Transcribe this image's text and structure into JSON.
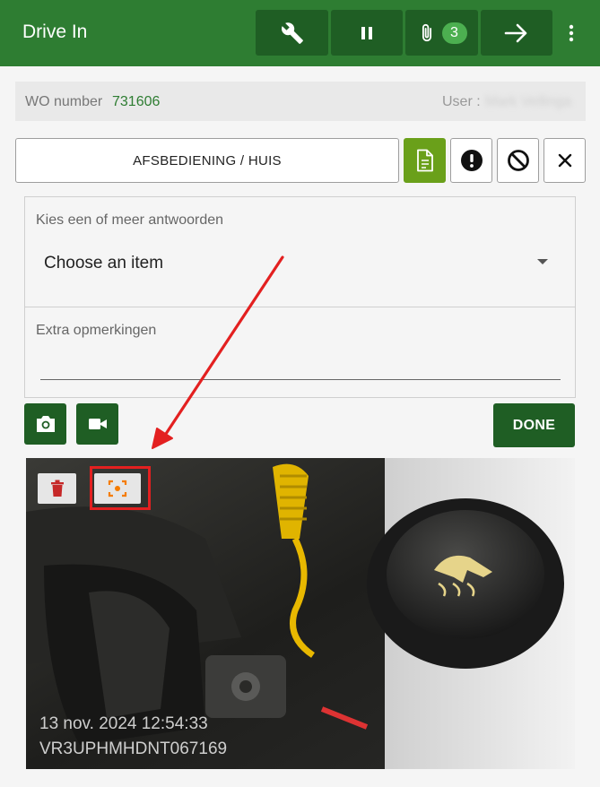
{
  "app": {
    "title": "Drive In",
    "attachments_count": "3"
  },
  "toolbar": {
    "buttons": [
      {
        "icon": "wrench-icon"
      },
      {
        "icon": "pause-icon"
      },
      {
        "icon": "paperclip-icon"
      },
      {
        "icon": "arrow-right-icon"
      }
    ],
    "menu_icon": "more-vert-icon"
  },
  "work_order": {
    "label": "WO number",
    "number": "731606",
    "user_label": "User :",
    "user_value": "Mark Vellinga"
  },
  "section": {
    "title": "AFSBEDIENING / HUIS",
    "actions": [
      {
        "icon": "document-icon",
        "color": "#6aa01a"
      },
      {
        "icon": "alert-circle-icon"
      },
      {
        "icon": "block-icon"
      },
      {
        "icon": "close-icon"
      }
    ]
  },
  "question": {
    "label": "Kies een of meer antwoorden",
    "select_value": "Choose an item",
    "extra_label": "Extra opmerkingen",
    "extra_value": ""
  },
  "media": {
    "camera_icon": "camera-icon",
    "video_icon": "video-camera-icon",
    "done_label": "DONE"
  },
  "photo": {
    "timestamp": "13 nov. 2024 12:54:33",
    "vin": "VR3UPHMHDNT067169",
    "delete_icon": "trash-icon",
    "focus_icon": "focus-crop-icon"
  },
  "colors": {
    "header": "#2e7d32",
    "button_dark": "#1f5e24",
    "doc_button": "#6aa01a",
    "accent_text": "#2e7d32",
    "annotation": "#e32020",
    "focus_icon": "#f57c00",
    "trash_icon": "#c62828"
  }
}
